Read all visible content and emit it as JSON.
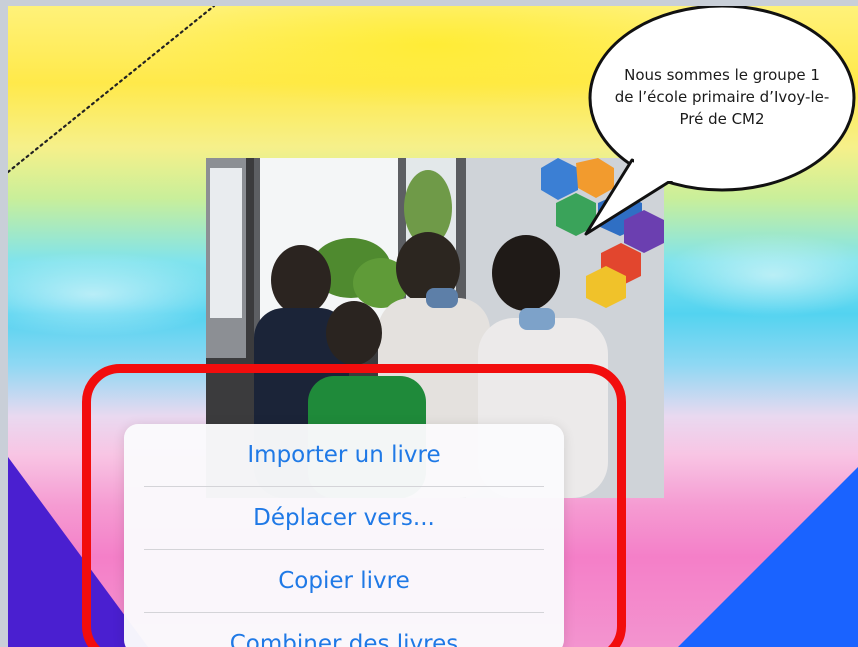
{
  "speech_bubble": {
    "line1": "Nous sommes le groupe 1",
    "line2": "de l’école primaire d’Ivoy-le-",
    "line3": "Pré de CM2"
  },
  "context_menu": {
    "items": [
      {
        "label": "Importer un livre",
        "icon": "none"
      },
      {
        "label": "Déplacer vers...",
        "icon": "none"
      },
      {
        "label": "Copier livre",
        "icon": "none"
      },
      {
        "label": "Combiner des livres",
        "icon": "none"
      }
    ],
    "text_color": "#1f79e6"
  },
  "annotation": {
    "highlight_color": "#f20d0d"
  },
  "colors": {
    "background_top": "#ffe94a",
    "background_mid": "#53d3f0",
    "background_bottom": "#f47fc8",
    "triangle_left": "#4a1fd0",
    "triangle_right": "#1a63ff"
  }
}
